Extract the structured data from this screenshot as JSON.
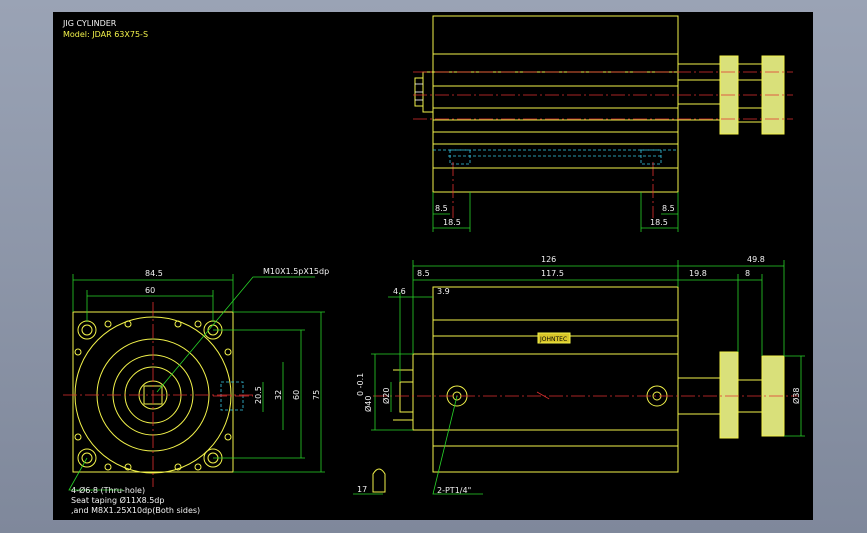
{
  "title": {
    "name": "JIG CYLINDER",
    "model": "Model: JDAR 63X75-S"
  },
  "top_view": {
    "dims": {
      "a": "8.5",
      "b": "18.5",
      "c": "8.5",
      "d": "18.5"
    }
  },
  "front_view": {
    "dims": {
      "width_outer": "84.5",
      "width_inner": "60",
      "h_80": "80",
      "h_60": "60",
      "h_32": "32",
      "h_20_5": "20.5",
      "h_75": "75"
    },
    "callout_thread": "M10X1.5pX15dp",
    "note_line1": "4-Ø6.8  (Thru-hole)",
    "note_line2": "Seat taping Ø11X8.5dp",
    "note_line3": ",and M8X1.25X10dp(Both sides)"
  },
  "side_view": {
    "dims": {
      "total": "126",
      "extra": "49.8",
      "d_8_5": "8.5",
      "d_117_5": "117.5",
      "d_19_8": "19.8",
      "d_8": "8",
      "d_4_6": "4.6",
      "d_3_9": "3.9",
      "dia_40": "Ø40",
      "dia_40_tol": "0 -0.1",
      "dia_20": "Ø20",
      "dia_38": "Ø38",
      "d_17": "17"
    },
    "port_callout": "2-PT1/4\"",
    "label_plate": "JOHNTEC"
  },
  "colors": {
    "background": "#000000",
    "outline": "#f2f24a",
    "dimension": "#28d428",
    "centerline": "#e03030",
    "hidden": "#37c9e6",
    "text": "#f2f2f2"
  }
}
